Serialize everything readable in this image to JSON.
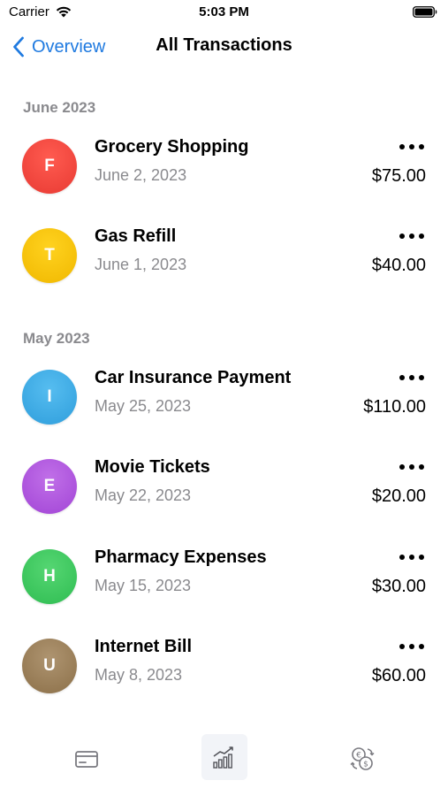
{
  "status_bar": {
    "carrier": "Carrier",
    "time": "5:03 PM"
  },
  "nav": {
    "back_label": "Overview",
    "title": "All Transactions"
  },
  "sections": [
    {
      "header": "June 2023",
      "items": [
        {
          "initial": "F",
          "title": "Grocery Shopping",
          "date": "June 2, 2023",
          "amount": "$75.00",
          "color": "#f2463f"
        },
        {
          "initial": "T",
          "title": "Gas Refill",
          "date": "June 1, 2023",
          "amount": "$40.00",
          "color": "#f6c106"
        }
      ]
    },
    {
      "header": "May 2023",
      "items": [
        {
          "initial": "I",
          "title": "Car Insurance Payment",
          "date": "May 25, 2023",
          "amount": "$110.00",
          "color": "#3aaae6"
        },
        {
          "initial": "E",
          "title": "Movie Tickets",
          "date": "May 22, 2023",
          "amount": "$20.00",
          "color": "#b057dd"
        },
        {
          "initial": "H",
          "title": "Pharmacy Expenses",
          "date": "May 15, 2023",
          "amount": "$30.00",
          "color": "#3ec95c"
        },
        {
          "initial": "U",
          "title": "Internet Bill",
          "date": "May 8, 2023",
          "amount": "$60.00",
          "color": "#9c8159"
        }
      ]
    }
  ],
  "tab_bar": {
    "tabs": [
      {
        "icon": "credit-card-icon",
        "selected": false
      },
      {
        "icon": "chart-icon",
        "selected": true
      },
      {
        "icon": "currency-exchange-icon",
        "selected": false
      }
    ]
  },
  "colors": {
    "accent": "#1f7ae0",
    "secondary_text": "#8a8a8e"
  }
}
